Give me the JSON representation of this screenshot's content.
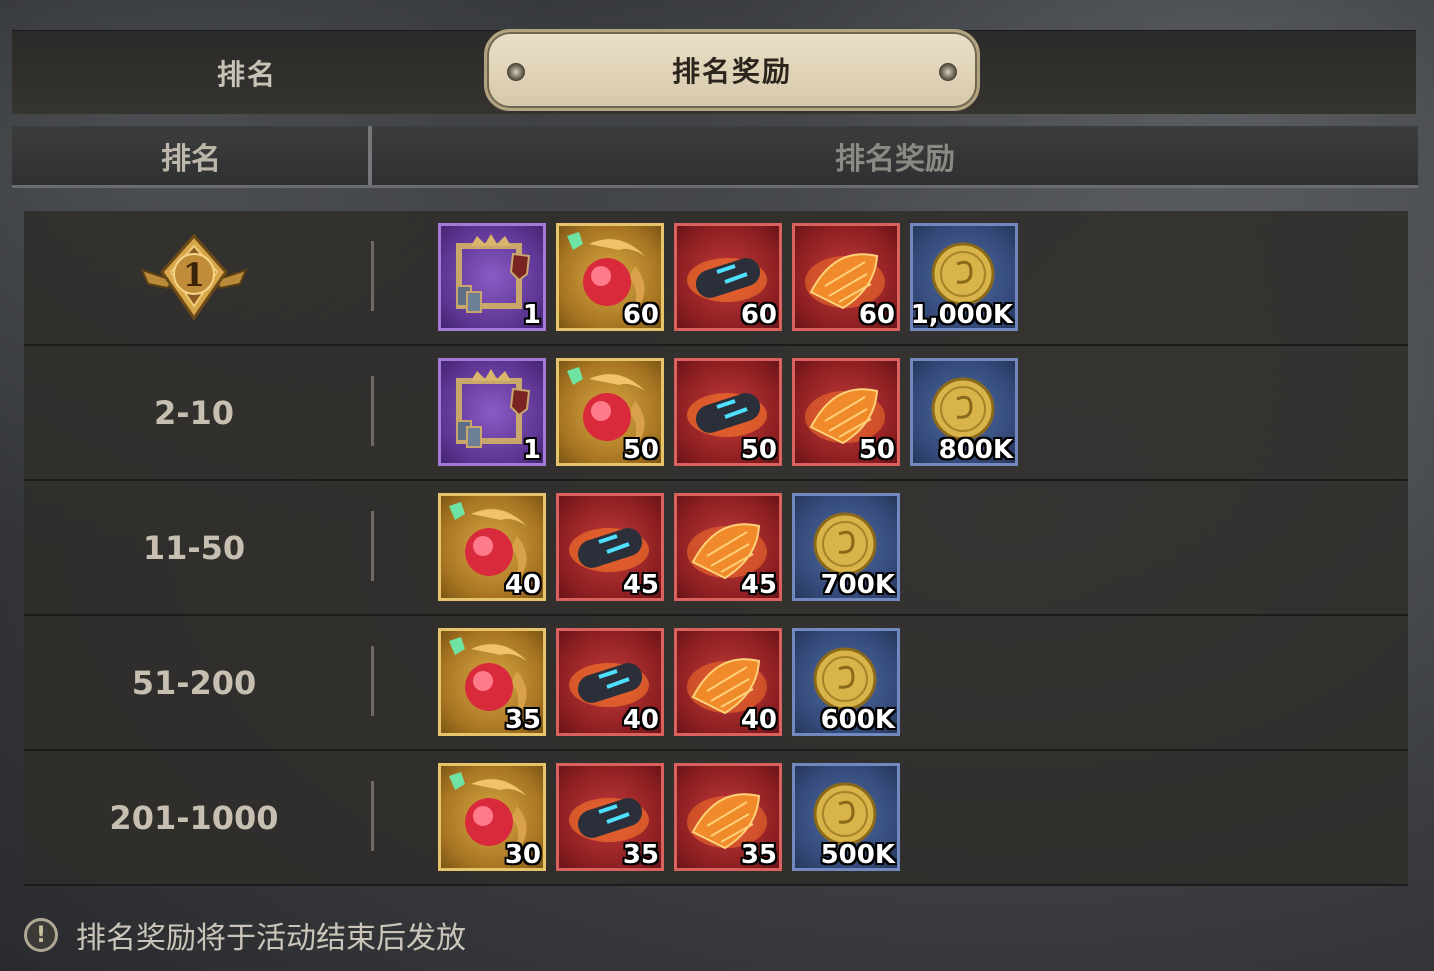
{
  "tabs": [
    {
      "label": "排名",
      "active": false
    },
    {
      "label": "排名奖励",
      "active": true
    }
  ],
  "table": {
    "header_rank": "排名",
    "header_reward": "排名奖励"
  },
  "rows": [
    {
      "rank_icon": "rank-1-medal-icon",
      "rank_number": "1",
      "items": [
        {
          "icon": "avatar-frame-icon",
          "rarity": "purple",
          "qty": "1"
        },
        {
          "icon": "red-gem-icon",
          "rarity": "gold",
          "qty": "60"
        },
        {
          "icon": "scroll-icon",
          "rarity": "red",
          "qty": "60"
        },
        {
          "icon": "dragon-scale-icon",
          "rarity": "red",
          "qty": "60"
        },
        {
          "icon": "gold-coin-icon",
          "rarity": "blue",
          "qty": "1,000K"
        }
      ]
    },
    {
      "rank": "2-10",
      "items": [
        {
          "icon": "avatar-frame-icon",
          "rarity": "purple",
          "qty": "1"
        },
        {
          "icon": "red-gem-icon",
          "rarity": "gold",
          "qty": "50"
        },
        {
          "icon": "scroll-icon",
          "rarity": "red",
          "qty": "50"
        },
        {
          "icon": "dragon-scale-icon",
          "rarity": "red",
          "qty": "50"
        },
        {
          "icon": "gold-coin-icon",
          "rarity": "blue",
          "qty": "800K"
        }
      ]
    },
    {
      "rank": "11-50",
      "items": [
        {
          "icon": "red-gem-icon",
          "rarity": "gold",
          "qty": "40"
        },
        {
          "icon": "scroll-icon",
          "rarity": "red",
          "qty": "45"
        },
        {
          "icon": "dragon-scale-icon",
          "rarity": "red",
          "qty": "45"
        },
        {
          "icon": "gold-coin-icon",
          "rarity": "blue",
          "qty": "700K"
        }
      ]
    },
    {
      "rank": "51-200",
      "items": [
        {
          "icon": "red-gem-icon",
          "rarity": "gold",
          "qty": "35"
        },
        {
          "icon": "scroll-icon",
          "rarity": "red",
          "qty": "40"
        },
        {
          "icon": "dragon-scale-icon",
          "rarity": "red",
          "qty": "40"
        },
        {
          "icon": "gold-coin-icon",
          "rarity": "blue",
          "qty": "600K"
        }
      ]
    },
    {
      "rank": "201-1000",
      "items": [
        {
          "icon": "red-gem-icon",
          "rarity": "gold",
          "qty": "30"
        },
        {
          "icon": "scroll-icon",
          "rarity": "red",
          "qty": "35"
        },
        {
          "icon": "dragon-scale-icon",
          "rarity": "red",
          "qty": "35"
        },
        {
          "icon": "gold-coin-icon",
          "rarity": "blue",
          "qty": "500K"
        }
      ]
    }
  ],
  "footer_note": "排名奖励将于活动结束后发放",
  "colors": {
    "active_tab_bg": "#eadfc7",
    "purple_rarity": "#5d3593",
    "gold_rarity": "#a77522",
    "red_rarity": "#8e1f22",
    "blue_rarity": "#344a7a"
  }
}
